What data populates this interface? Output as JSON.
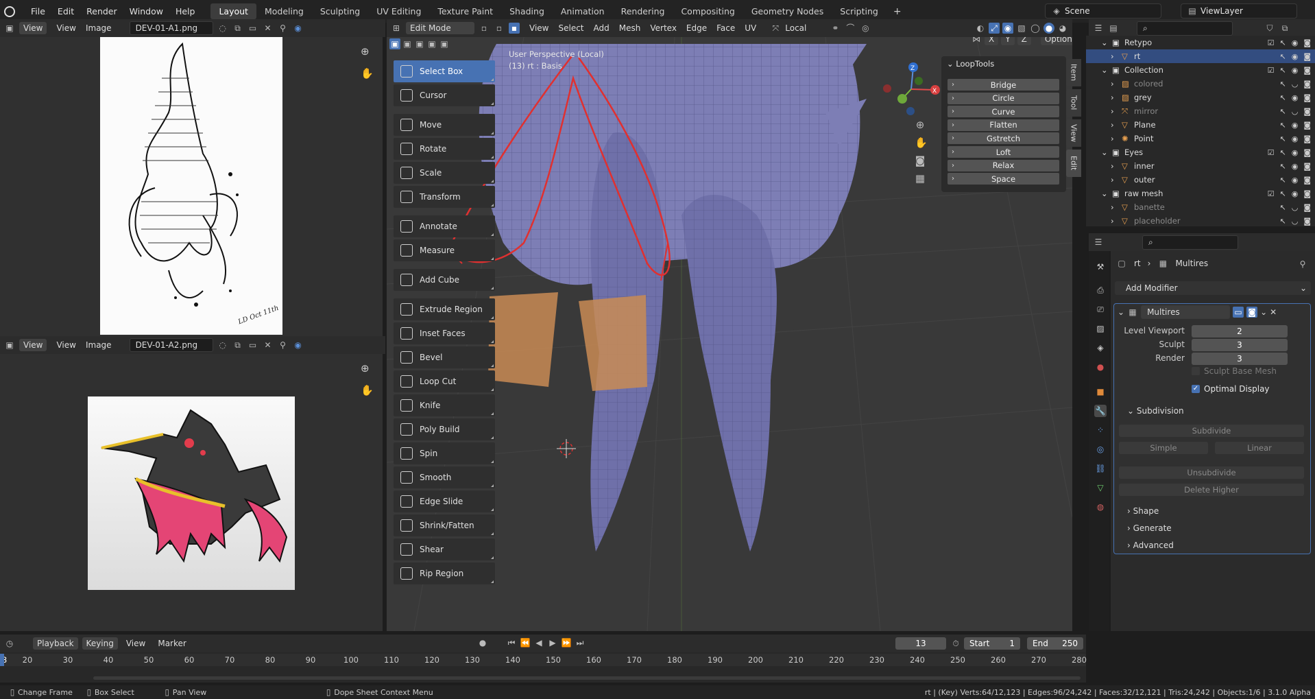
{
  "topbar": {
    "menus": [
      "File",
      "Edit",
      "Render",
      "Window",
      "Help"
    ],
    "workspaces": [
      "Layout",
      "Modeling",
      "Sculpting",
      "UV Editing",
      "Texture Paint",
      "Shading",
      "Animation",
      "Rendering",
      "Compositing",
      "Geometry Nodes",
      "Scripting"
    ],
    "active_workspace": "Layout",
    "add_tab": "+",
    "scene": "Scene",
    "view_layer": "ViewLayer"
  },
  "image_editor_1": {
    "view": "View",
    "menu_view": "View",
    "menu_image": "Image",
    "image_name": "DEV-01-A1.png"
  },
  "image_editor_2": {
    "view": "View",
    "menu_view": "View",
    "menu_image": "Image",
    "image_name": "DEV-01-A2.png"
  },
  "sketch_signature": "LD Oct 11th",
  "viewport": {
    "mode": "Edit Mode",
    "menus": [
      "View",
      "Select",
      "Add",
      "Mesh",
      "Vertex",
      "Edge",
      "Face",
      "UV"
    ],
    "transform_orientation": "Local",
    "axes": [
      "X",
      "Y",
      "Z"
    ],
    "options": "Options",
    "overlay_title": "User Perspective (Local)",
    "overlay_subtitle": "(13) rt : Basis",
    "gizmo": {
      "z": "Z",
      "y": "Y",
      "x": "X"
    },
    "side_tabs": [
      "Item",
      "Tool",
      "View",
      "Edit"
    ]
  },
  "toolbar": [
    {
      "label": "Select Box",
      "selected": true
    },
    {
      "label": "Cursor"
    },
    {
      "label": "Move"
    },
    {
      "label": "Rotate"
    },
    {
      "label": "Scale"
    },
    {
      "label": "Transform"
    },
    {
      "label": "Annotate"
    },
    {
      "label": "Measure"
    },
    {
      "label": "Add Cube"
    },
    {
      "label": "Extrude Region"
    },
    {
      "label": "Inset Faces"
    },
    {
      "label": "Bevel"
    },
    {
      "label": "Loop Cut"
    },
    {
      "label": "Knife"
    },
    {
      "label": "Poly Build"
    },
    {
      "label": "Spin"
    },
    {
      "label": "Smooth"
    },
    {
      "label": "Edge Slide"
    },
    {
      "label": "Shrink/Fatten"
    },
    {
      "label": "Shear"
    },
    {
      "label": "Rip Region"
    }
  ],
  "looptools": {
    "title": "LoopTools",
    "items": [
      "Bridge",
      "Circle",
      "Curve",
      "Flatten",
      "Gstretch",
      "Loft",
      "Relax",
      "Space"
    ]
  },
  "outliner": [
    {
      "name": "Retypo",
      "type": "collection",
      "level": 0
    },
    {
      "name": "rt",
      "type": "mesh",
      "level": 1,
      "selected": true
    },
    {
      "name": "Collection",
      "type": "collection",
      "level": 0
    },
    {
      "name": "colored",
      "type": "image",
      "level": 1,
      "dim": true
    },
    {
      "name": "grey",
      "type": "image",
      "level": 1
    },
    {
      "name": "mirror",
      "type": "empty",
      "level": 1,
      "dim": true
    },
    {
      "name": "Plane",
      "type": "mesh",
      "level": 1
    },
    {
      "name": "Point",
      "type": "light",
      "level": 1
    },
    {
      "name": "Eyes",
      "type": "collection",
      "level": 0
    },
    {
      "name": "inner",
      "type": "mesh",
      "level": 1
    },
    {
      "name": "outer",
      "type": "mesh",
      "level": 1
    },
    {
      "name": "raw mesh",
      "type": "collection",
      "level": 0
    },
    {
      "name": "banette",
      "type": "mesh",
      "level": 1,
      "dim": true
    },
    {
      "name": "placeholder",
      "type": "mesh",
      "level": 1,
      "dim": true
    }
  ],
  "properties": {
    "breadcrumb_object": "rt",
    "breadcrumb_modifier": "Multires",
    "add_modifier": "Add Modifier",
    "modifier_name": "Multires",
    "fields": [
      {
        "label": "Level Viewport",
        "value": "2"
      },
      {
        "label": "Sculpt",
        "value": "3"
      },
      {
        "label": "Render",
        "value": "3"
      }
    ],
    "sculpt_base_mesh": "Sculpt Base Mesh",
    "optimal_display": "Optimal Display",
    "subdivision": "Subdivision",
    "subdivide": "Subdivide",
    "simple": "Simple",
    "linear": "Linear",
    "unsubdivide": "Unsubdivide",
    "delete_higher": "Delete Higher",
    "sections": [
      "Shape",
      "Generate",
      "Advanced"
    ]
  },
  "timeline": {
    "menus": [
      "Playback",
      "Keying",
      "View",
      "Marker"
    ],
    "current_frame": "13",
    "start_label": "Start",
    "start": "1",
    "end_label": "End",
    "end": "250",
    "ticks": [
      "3",
      "20",
      "30",
      "40",
      "50",
      "60",
      "70",
      "80",
      "90",
      "100",
      "110",
      "120",
      "130",
      "140",
      "150",
      "160",
      "170",
      "180",
      "190",
      "200",
      "210",
      "220",
      "230",
      "240",
      "250",
      "260",
      "270",
      "280"
    ]
  },
  "statusbar": {
    "items": [
      "Change Frame",
      "Box Select",
      "Pan View",
      "Dope Sheet Context Menu"
    ],
    "stats": "rt | (Key) Verts:64/12,123 | Edges:96/24,242 | Faces:32/12,121 | Tris:24,242 | Objects:1/6 | 3.1.0 Alpha"
  },
  "colors": {
    "accent": "#4772b3",
    "selected_edge": "#e03030",
    "selected_face": "#d9944a",
    "mesh": "#7d7eb5"
  }
}
